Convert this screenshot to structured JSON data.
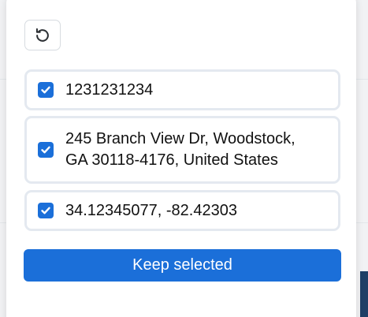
{
  "toolbar": {
    "undo_icon": "undo-icon"
  },
  "options": [
    {
      "label": "1231231234",
      "checked": true
    },
    {
      "label": "245 Branch View Dr, Woodstock, GA 30118-4176, United States",
      "checked": true
    },
    {
      "label": "34.12345077, -82.42303",
      "checked": true
    }
  ],
  "actions": {
    "keep_selected_label": "Keep selected"
  },
  "colors": {
    "accent": "#1b6fd9",
    "option_border": "#e4e9f0",
    "panel_background": "#ffffff"
  }
}
